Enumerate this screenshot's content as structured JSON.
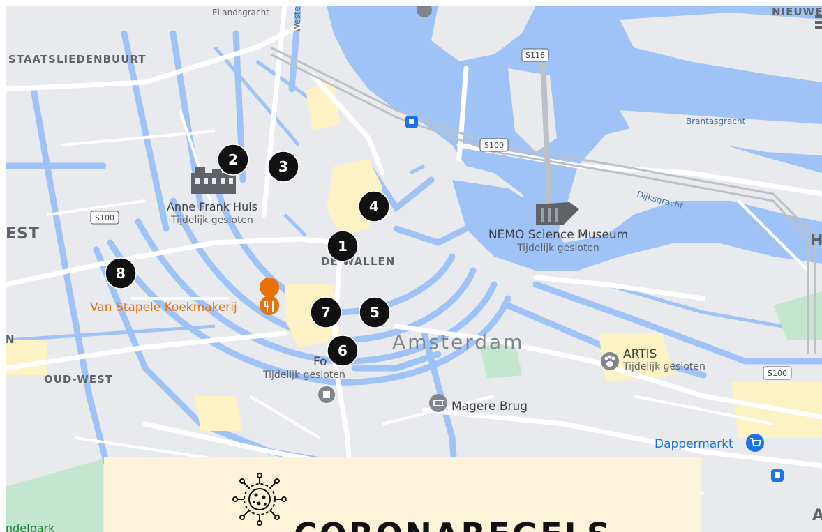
{
  "map": {
    "districts": {
      "staatsliedenbuurt": "STAATSLIEDENBUURT",
      "west": "EST",
      "oud_west": "OUD-WEST",
      "de_wallen": "DE WALLEN",
      "nieuwe": "NIEUWE",
      "h_edge": "H",
      "a_edge": "A",
      "n_edge": "N"
    },
    "city_name": "Amsterdam",
    "streets": {
      "eilandsgracht": "Eilandsgracht",
      "westerdok": "Westerd",
      "brantasgracht": "Brantasgracht",
      "dijksgracht": "Dijksgracht"
    },
    "roads": {
      "s116": "S116",
      "s100_a": "S100",
      "s100_b": "S100",
      "s100_c": "S100"
    },
    "pois": {
      "anne_frank": {
        "name": "Anne Frank Huis",
        "status": "Tijdelijk gesloten"
      },
      "nemo": {
        "name": "NEMO Science Museum",
        "status": "Tijdelijk gesloten"
      },
      "van_stapele": {
        "name": "Van Stapele Koekmakerij"
      },
      "artis": {
        "name": "ARTIS",
        "status": "Tijdelijk gesloten"
      },
      "foam": {
        "name": "Fo",
        "status": "Tijdelijk gesloten"
      },
      "magere_brug": {
        "name": "Magere Brug"
      },
      "dappermarkt": {
        "name": "Dappermarkt"
      },
      "vondelpark": {
        "name": "ndelpark"
      }
    },
    "markers": [
      "1",
      "2",
      "3",
      "4",
      "5",
      "6",
      "7",
      "8"
    ],
    "colors": {
      "water": "#9fc3f6",
      "land": "#e8eaed",
      "road": "#ffffff",
      "park": "#c4e5cf",
      "sand": "#fdf2c4",
      "food": "#e8710a",
      "blue_poi": "#1a73e8"
    }
  },
  "card": {
    "title": "CORONAREGELS",
    "icon": "virus-icon"
  }
}
